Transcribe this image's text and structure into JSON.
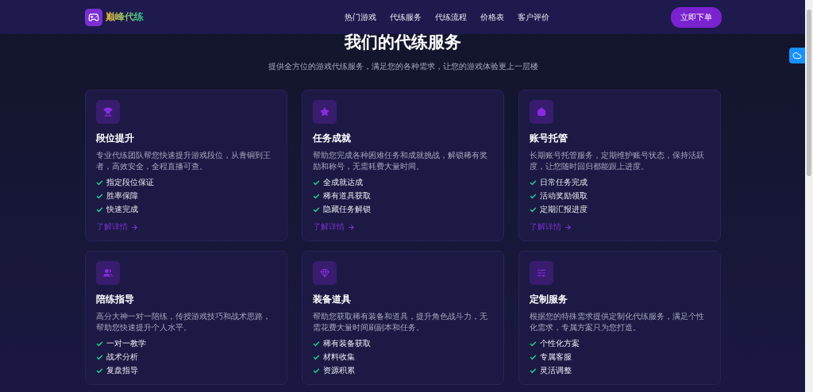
{
  "header": {
    "logo": "巅峰代练",
    "nav": [
      "热门游戏",
      "代练服务",
      "代练流程",
      "价格表",
      "客户评价"
    ],
    "cta": "立即下单"
  },
  "section": {
    "title": "我们的代练服务",
    "subtitle": "提供全方位的游戏代练服务，满足您的各种需求，让您的游戏体验更上一层楼"
  },
  "cards": [
    {
      "title": "段位提升",
      "description": "专业代练团队帮您快速提升游戏段位，从青铜到王者，高效安全，全程直播可查。",
      "features": [
        "指定段位保证",
        "胜率保障",
        "快速完成"
      ],
      "link": "了解详情"
    },
    {
      "title": "任务成就",
      "description": "帮助您完成各种困难任务和成就挑战，解锁稀有奖励和称号，无需耗费大量时间。",
      "features": [
        "全成就达成",
        "稀有道具获取",
        "隐藏任务解锁"
      ],
      "link": "了解详情"
    },
    {
      "title": "账号托管",
      "description": "长期账号托管服务，定期维护账号状态，保持活跃度，让您随时回归都能跟上进度。",
      "features": [
        "日常任务完成",
        "活动奖励领取",
        "定期汇报进度"
      ],
      "link": "了解详情"
    },
    {
      "title": "陪练指导",
      "description": "高分大神一对一陪练，传授游戏技巧和战术思路，帮助您快速提升个人水平。",
      "features": [
        "一对一教学",
        "战术分析",
        "复盘指导"
      ]
    },
    {
      "title": "装备道具",
      "description": "帮助您获取稀有装备和道具，提升角色战斗力，无需花费大量时间刷副本和任务。",
      "features": [
        "稀有装备获取",
        "材料收集",
        "资源积累"
      ]
    },
    {
      "title": "定制服务",
      "description": "根据您的特殊需求提供定制化代练服务，满足个性化需求，专属方案只为您打造。",
      "features": [
        "个性化方案",
        "专属客服",
        "灵活调整"
      ]
    }
  ]
}
